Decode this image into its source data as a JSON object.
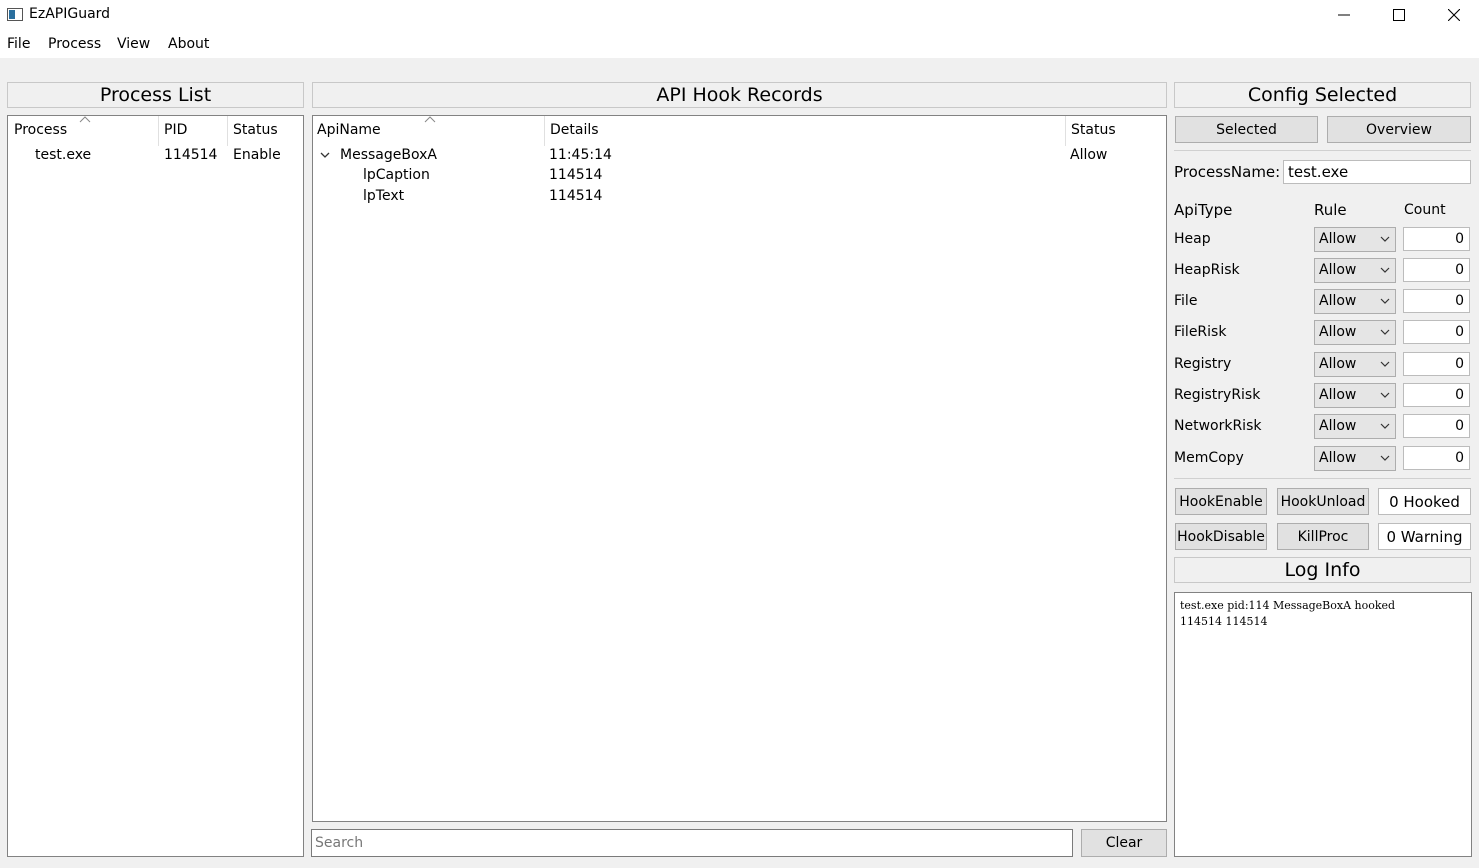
{
  "window": {
    "title": "EzAPIGuard",
    "controls": {
      "minimize": "minimize",
      "maximize": "maximize",
      "close": "close"
    }
  },
  "menu": [
    "File",
    "Process",
    "View",
    "About"
  ],
  "process_panel": {
    "title": "Process List",
    "columns": [
      "Process",
      "PID",
      "Status"
    ],
    "rows": [
      {
        "process": "test.exe",
        "pid": "114514",
        "status": "Enable"
      }
    ]
  },
  "records_panel": {
    "title": "API Hook Records",
    "columns": [
      "ApiName",
      "Details",
      "Status"
    ],
    "rows": [
      {
        "name": "MessageBoxA",
        "details": "11:45:14",
        "status": "Allow",
        "expanded": true,
        "children": [
          {
            "name": "lpCaption",
            "details": "114514"
          },
          {
            "name": "lpText",
            "details": "114514"
          }
        ]
      }
    ],
    "search_placeholder": "Search",
    "clear_label": "Clear"
  },
  "config_panel": {
    "title": "Config Selected",
    "tabs": [
      "Selected",
      "Overview"
    ],
    "process_name_label": "ProcessName:",
    "process_name_value": "test.exe",
    "headers": {
      "api_type": "ApiType",
      "rule": "Rule",
      "count": "Count"
    },
    "rules": [
      {
        "type": "Heap",
        "rule": "Allow",
        "count": "0"
      },
      {
        "type": "HeapRisk",
        "rule": "Allow",
        "count": "0"
      },
      {
        "type": "File",
        "rule": "Allow",
        "count": "0"
      },
      {
        "type": "FileRisk",
        "rule": "Allow",
        "count": "0"
      },
      {
        "type": "Registry",
        "rule": "Allow",
        "count": "0"
      },
      {
        "type": "RegistryRisk",
        "rule": "Allow",
        "count": "0"
      },
      {
        "type": "NetworkRisk",
        "rule": "Allow",
        "count": "0"
      },
      {
        "type": "MemCopy",
        "rule": "Allow",
        "count": "0"
      }
    ],
    "actions": {
      "hook_enable": "HookEnable",
      "hook_unload": "HookUnload",
      "hook_disable": "HookDisable",
      "kill_proc": "KillProc"
    },
    "hooked_readout": "0 Hooked",
    "warning_readout": "0 Warning"
  },
  "log_panel": {
    "title": "Log Info",
    "text": "test.exe pid:114 MessageBoxA hooked\n114514 114514"
  },
  "colors": {
    "window_bg": "#f0f0f0",
    "view_bg": "#ffffff",
    "button_bg": "#e1e1e1"
  },
  "icons": [
    "app-icon",
    "minimize-icon",
    "maximize-icon",
    "close-icon",
    "sort-up-icon",
    "chevron-down-icon"
  ]
}
